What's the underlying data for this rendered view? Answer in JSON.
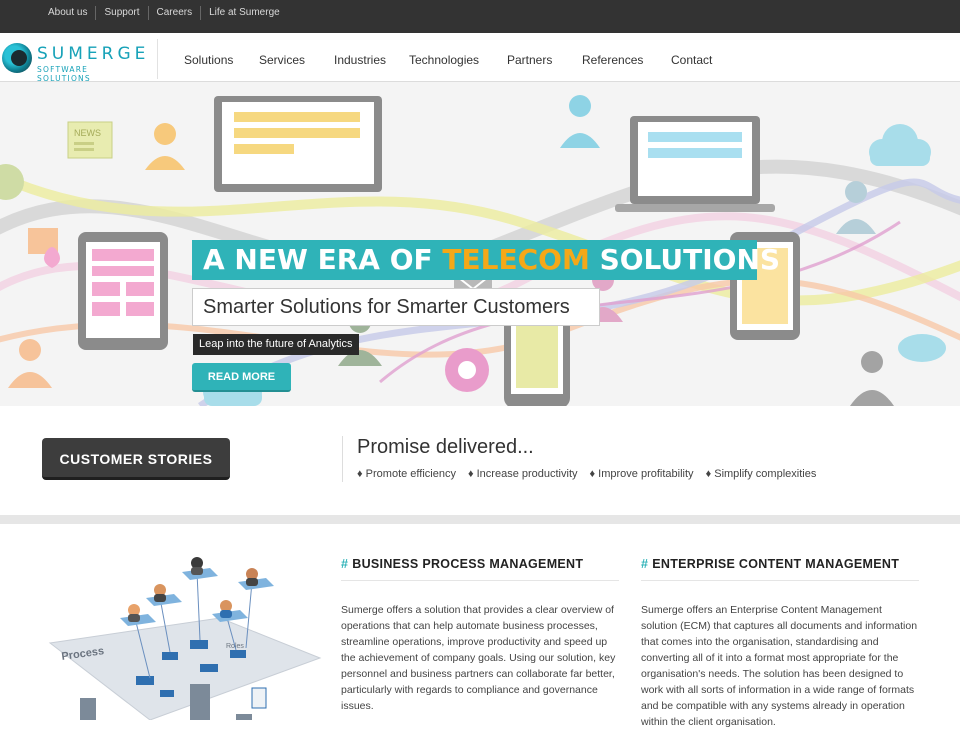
{
  "topbar": {
    "links": [
      "About us",
      "Support",
      "Careers",
      "Life at Sumerge"
    ]
  },
  "logo": {
    "name": "SUMERGE",
    "sub": "SOFTWARE SOLUTIONS"
  },
  "nav": [
    "Solutions",
    "Services",
    "Industries",
    "Technologies",
    "Partners",
    "References",
    "Contact"
  ],
  "hero": {
    "title_pre": "A NEW ERA OF ",
    "title_highlight": "TELECOM",
    "title_post": " SOLUTIONS",
    "subtitle": "Smarter Solutions for Smarter Customers",
    "tagline": "Leap into the future of Analytics",
    "button": "READ MORE",
    "icon_labels": {
      "news": "NEWS",
      "process": "Process",
      "roles": "Roles"
    }
  },
  "promise": {
    "button": "CUSTOMER STORIES",
    "title": "Promise delivered...",
    "items": [
      "♦ Promote efficiency",
      "♦ Increase productivity",
      "♦ Improve profitability",
      "♦ Simplify complexities"
    ]
  },
  "sections": [
    {
      "hash": "#",
      "title": "BUSINESS PROCESS MANAGEMENT",
      "body": "Sumerge offers a solution that provides a clear overview of operations that can help automate business processes, streamline operations, improve productivity and speed up the achievement of company goals. Using our solution, key personnel and business partners can collaborate far better, particularly with regards to compliance and governance issues."
    },
    {
      "hash": "#",
      "title": "ENTERPRISE CONTENT MANAGEMENT",
      "body": "Sumerge offers an Enterprise Content Management solution (ECM) that captures all documents and information that comes into the organisation, standardising and converting all of it into a format most appropriate for the organisation's needs. The solution has been designed to work with all sorts of information in a wide range of formats and be compatible with any systems already in operation within the client organisation."
    }
  ],
  "colors": {
    "accent": "#2fb3b8",
    "highlight": "#f5a818",
    "dark": "#333333"
  }
}
